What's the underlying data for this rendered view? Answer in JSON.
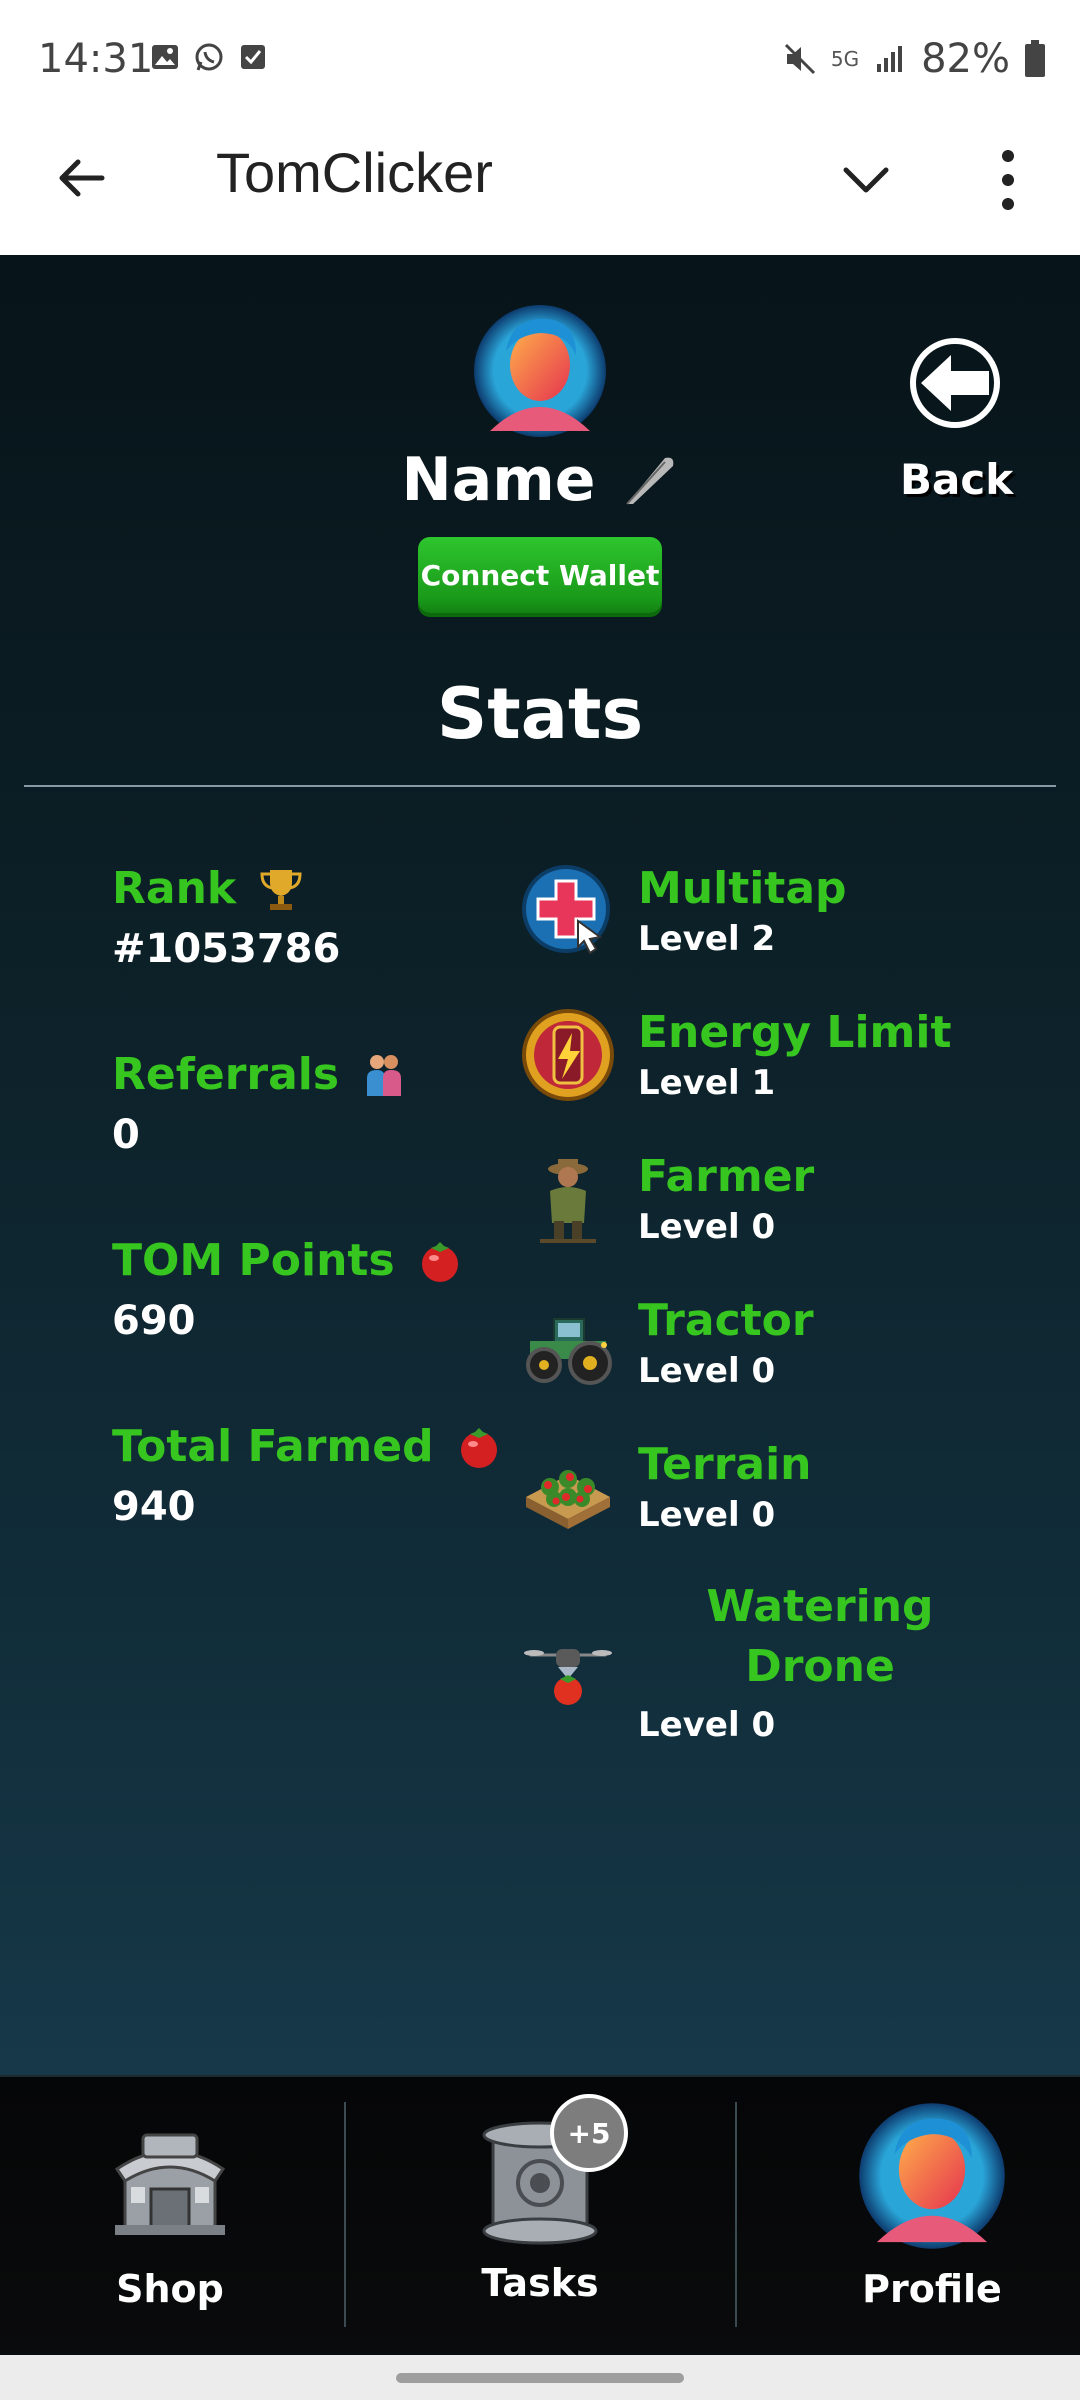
{
  "status_bar": {
    "time": "14:31",
    "battery": "82%",
    "network": "5G"
  },
  "app_bar": {
    "title": "TomClicker"
  },
  "profile": {
    "name": "Name",
    "connect_wallet": "Connect Wallet",
    "back_label": "Back"
  },
  "stats": {
    "title": "Stats",
    "left": [
      {
        "label": "Rank",
        "value": "#1053786",
        "icon": "trophy-icon"
      },
      {
        "label": "Referrals",
        "value": "0",
        "icon": "hug-icon"
      },
      {
        "label": "TOM Points",
        "value": "690",
        "icon": "tomato-icon"
      },
      {
        "label": "Total Farmed",
        "value": "940",
        "icon": "tomato-icon"
      }
    ],
    "upgrades": [
      {
        "name": "Multitap",
        "level": "Level 2",
        "icon": "multitap-icon"
      },
      {
        "name": "Energy Limit",
        "level": "Level 1",
        "icon": "energy-battery-icon"
      },
      {
        "name": "Farmer",
        "level": "Level 0",
        "icon": "farmer-icon"
      },
      {
        "name": "Tractor",
        "level": "Level 0",
        "icon": "tractor-icon"
      },
      {
        "name": "Terrain",
        "level": "Level 0",
        "icon": "terrain-icon"
      },
      {
        "name_line1": "Watering",
        "name_line2": "Drone",
        "level": "Level 0",
        "icon": "drone-icon"
      }
    ]
  },
  "nav": {
    "shop": "Shop",
    "tasks": "Tasks",
    "tasks_badge": "+5",
    "profile": "Profile"
  },
  "colors": {
    "accent_green": "#37c51f",
    "button_green": "#1a9a1a"
  }
}
